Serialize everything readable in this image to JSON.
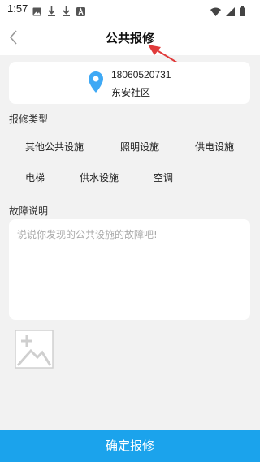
{
  "status_bar": {
    "time": "1:57",
    "left_icons": [
      "image-icon",
      "download-icon",
      "download-icon",
      "font-icon"
    ],
    "right_icons": [
      "wifi-icon",
      "signal-icon",
      "battery-icon"
    ]
  },
  "nav": {
    "title": "公共报修",
    "back_icon": "chevron-left-icon"
  },
  "address": {
    "phone": "18060520731",
    "community": "东安社区",
    "icon": "location-pin-icon",
    "icon_color": "#3fa9f5"
  },
  "repair_type": {
    "label": "报修类型",
    "options": [
      "其他公共设施",
      "照明设施",
      "供电设施",
      "电梯",
      "供水设施",
      "空调"
    ]
  },
  "fault": {
    "label": "故障说明",
    "placeholder": "说说你发现的公共设施的故障吧!",
    "value": ""
  },
  "photo": {
    "icon": "add-image-icon"
  },
  "submit": {
    "label": "确定报修",
    "color": "#1ba3ec"
  },
  "annotation": {
    "color": "#e03a3a"
  }
}
